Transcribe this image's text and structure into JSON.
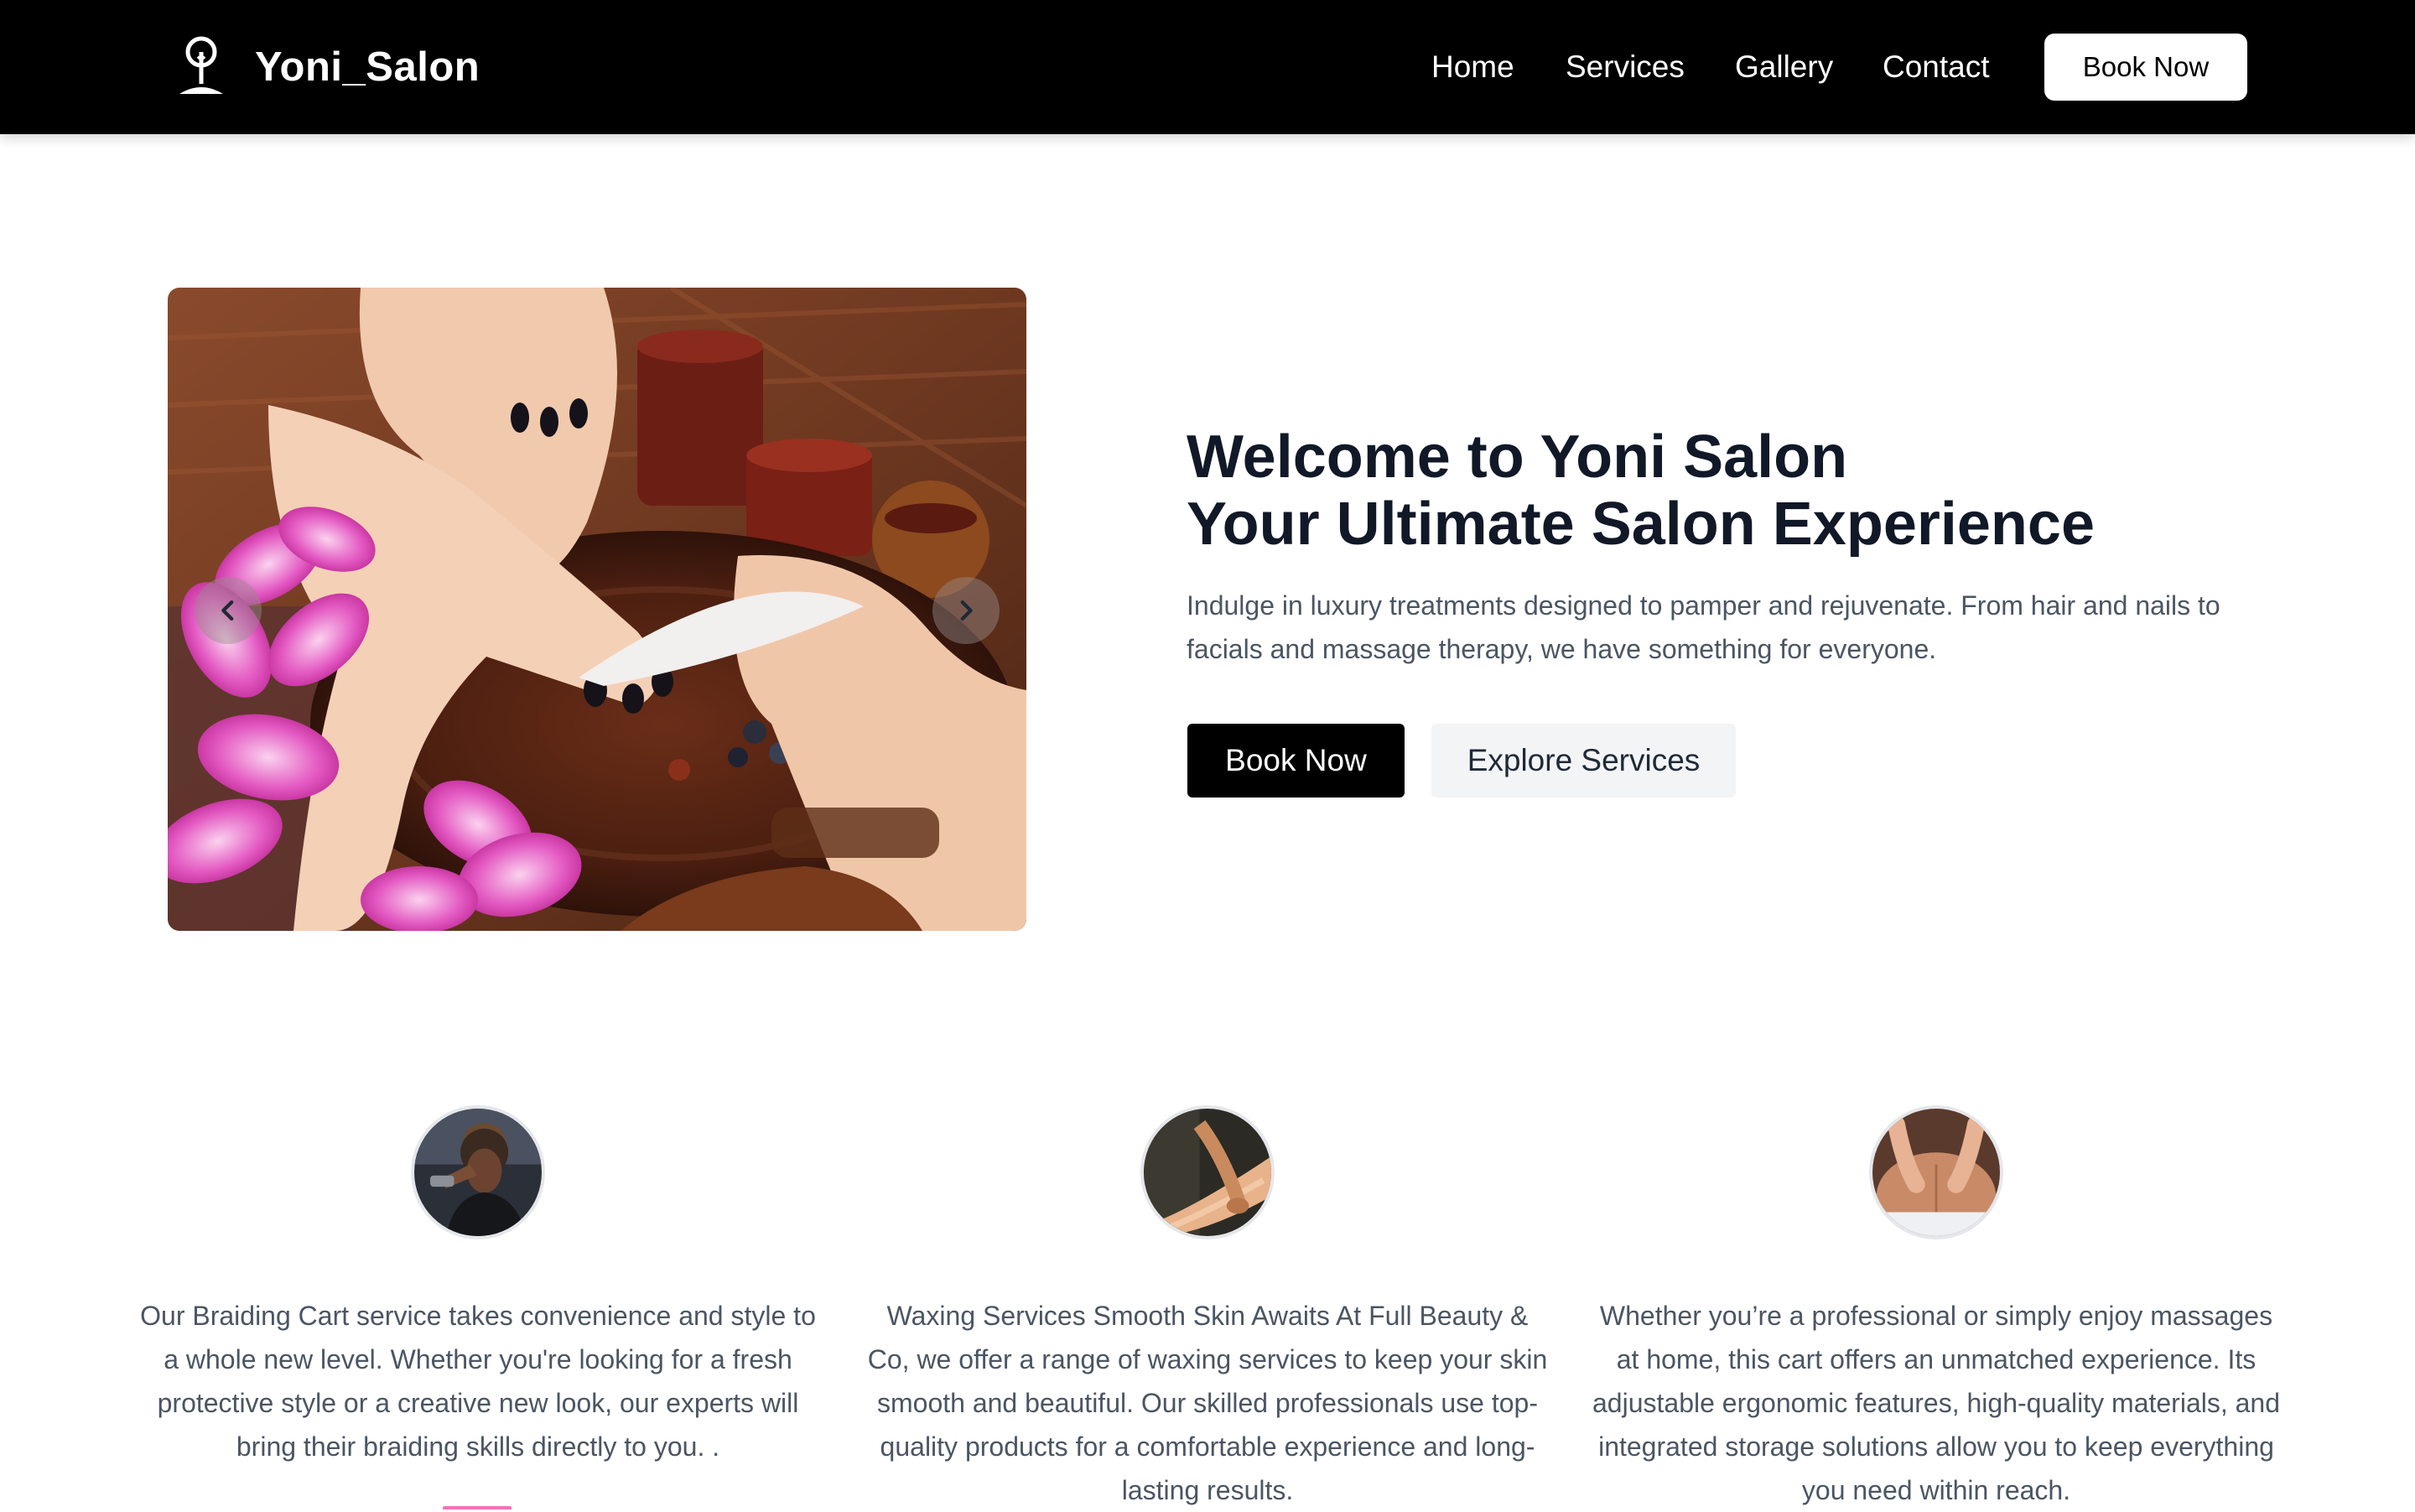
{
  "brand": {
    "name": "Yoni_Salon",
    "icon": "salon-logo-icon"
  },
  "nav": {
    "links": [
      "Home",
      "Services",
      "Gallery",
      "Contact"
    ],
    "cta": "Book Now"
  },
  "hero": {
    "title_line1": "Welcome to Yoni Salon",
    "title_line2": "Your Ultimate Salon Experience",
    "description": "Indulge in luxury treatments designed to pamper and rejuvenate. From hair and nails to facials and massage therapy, we have something for everyone.",
    "primary_button": "Book Now",
    "secondary_button": "Explore Services",
    "carousel": {
      "prev_icon": "chevron-left-icon",
      "next_icon": "chevron-right-icon"
    }
  },
  "services": [
    {
      "image": "braiding-photo",
      "text": "Our Braiding Cart service takes convenience and style to a whole new level. Whether you're looking for a fresh protective style or a creative new look, our experts will bring their braiding skills directly to you. ."
    },
    {
      "image": "waxing-photo",
      "text": "Waxing Services Smooth Skin Awaits At Full Beauty & Co, we offer a range of waxing services to keep your skin smooth and beautiful. Our skilled professionals use top-quality products for a comfortable experience and long-lasting results."
    },
    {
      "image": "massage-photo",
      "text": "Whether you’re a professional or simply enjoy massages at home, this cart offers an unmatched experience. Its adjustable ergonomic features, high-quality materials, and integrated storage solutions allow you to keep everything you need within reach."
    }
  ]
}
